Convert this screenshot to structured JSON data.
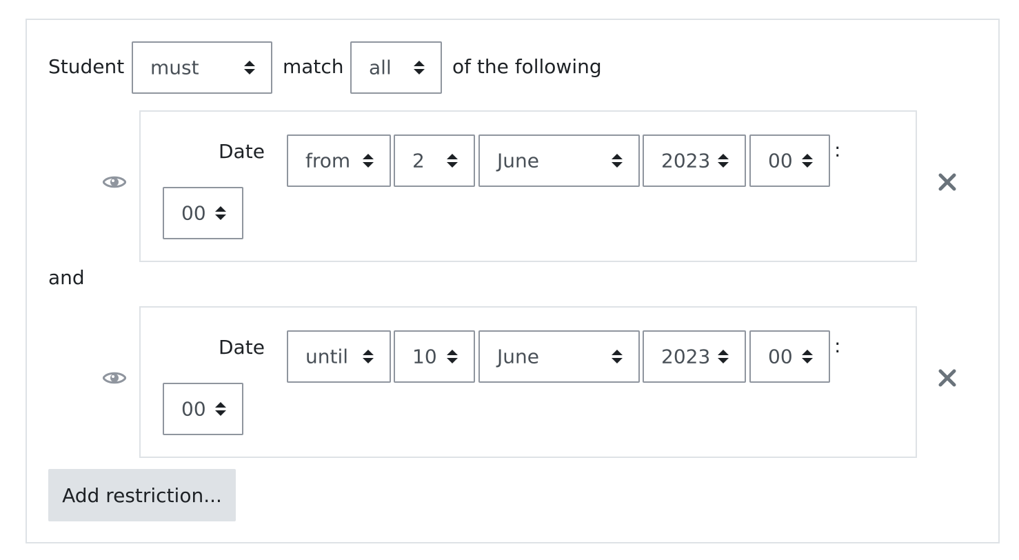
{
  "header": {
    "student_label": "Student",
    "must_select_value": "must",
    "match_label": "match",
    "all_select_value": "all",
    "following_label": "of the following"
  },
  "conditions": [
    {
      "label": "Date",
      "direction": "from",
      "day": "2",
      "month": "June",
      "year": "2023",
      "hour": "00",
      "separator": ":",
      "minute": "00"
    },
    {
      "label": "Date",
      "direction": "until",
      "day": "10",
      "month": "June",
      "year": "2023",
      "hour": "00",
      "separator": ":",
      "minute": "00"
    }
  ],
  "and_label": "and",
  "add_restriction_label": "Add restriction...",
  "icons": {
    "visibility": "eye-icon",
    "delete": "close-icon",
    "select_caret": "sort-caret-icon"
  },
  "colors": {
    "border": "#dee2e6",
    "select_border": "#8f959e",
    "button_bg": "#dee2e6",
    "icon_gray": "#8f959e",
    "close_gray": "#6a737b"
  }
}
